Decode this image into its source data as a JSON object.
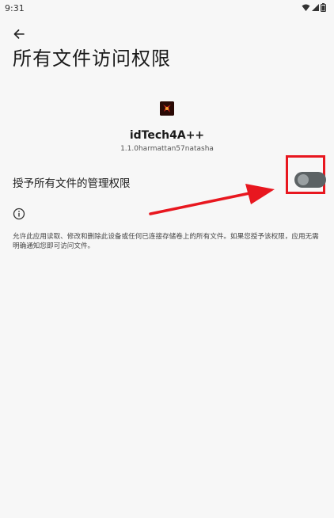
{
  "status": {
    "time": "9:31"
  },
  "header": {
    "title": "所有文件访问权限"
  },
  "app": {
    "name": "idTech4A++",
    "version": "1.1.0harmattan57natasha"
  },
  "permission": {
    "label": "授予所有文件的管理权限",
    "toggle_on": false
  },
  "info": {
    "text": "允许此应用读取、修改和删除此设备或任何已连接存储卷上的所有文件。如果您授予该权限，应用无需明确通知您即可访问文件。"
  },
  "colors": {
    "background": "#f7f7f7",
    "highlight": "#e8171f",
    "toggle_track": "#5c6264",
    "toggle_thumb": "#9aa0a2"
  },
  "icons": {
    "back": "arrow-left-icon",
    "info": "info-icon",
    "wifi": "wifi-icon",
    "signal": "signal-icon",
    "battery": "battery-icon"
  }
}
